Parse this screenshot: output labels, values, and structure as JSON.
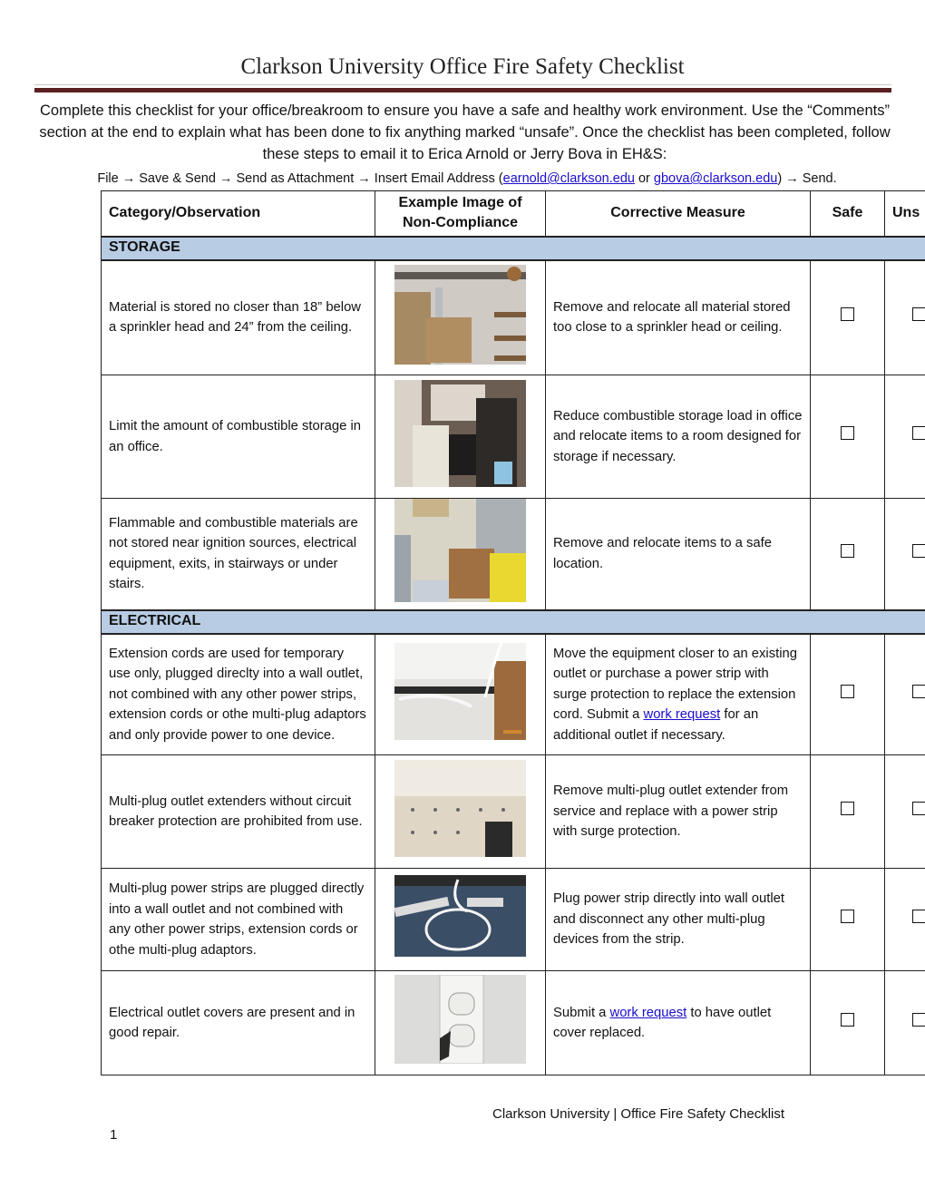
{
  "document": {
    "title": "Clarkson University Office Fire Safety Checklist",
    "intro": "Complete this checklist for your office/breakroom to ensure you have a safe and healthy work environment. Use the “Comments” section at the end to explain what has been done to fix anything marked “unsafe”.  Once the checklist has been completed, follow these steps to email it to Erica Arnold or Jerry Bova in EH&S:",
    "steps": {
      "part1": "File → Save & Send → Send as Attachment → Insert Email Address (",
      "email1": "earnold@clarkson.edu",
      "or": " or ",
      "email2": "gbova@clarkson.edu",
      "part2": ") → Send."
    }
  },
  "table": {
    "headers": {
      "category": "Category/Observation",
      "image": "Example Image of Non-Compliance",
      "measure": "Corrective Measure",
      "safe": "Safe",
      "unsafe": "Uns"
    },
    "sections": [
      {
        "name": "STORAGE",
        "rows": [
          {
            "observation": "Material is stored no closer than 18” below a sprinkler head and 24” from the ceiling.",
            "image_desc": "storage near sprinkler pipe",
            "measure": "Remove and relocate all material stored too close to a sprinkler head or ceiling."
          },
          {
            "observation": "Limit the amount of combustible storage in an office.",
            "image_desc": "cluttered office",
            "measure": "Reduce combustible storage load in office and relocate items to a room designed for storage if necessary."
          },
          {
            "observation": "Flammable and combustible materials are not stored near ignition sources, electrical equipment, exits, in stairways or under stairs.",
            "image_desc": "boxes near electrical panel",
            "measure": "Remove and relocate items to a safe location."
          }
        ]
      },
      {
        "name": "ELECTRICAL",
        "rows": [
          {
            "observation": "Extension cords are used for temporary use only, plugged direclty into a wall outlet, not combined with any other power strips, extension cords or othe multi-plug adaptors and only provide power to one device.",
            "image_desc": "extension cord along wall",
            "measure_pre": "Move the equipment closer to an existing outlet or purchase a power strip with surge protection to replace the extension cord.  Submit a ",
            "measure_link": "work request",
            "measure_post": " for an additional outlet if necessary."
          },
          {
            "observation": "Multi-plug outlet extenders without circuit breaker protection are prohibited from use.",
            "image_desc": "multi-plug outlet extender",
            "measure": "Remove  multi-plug outlet extender from service and replace with a power strip with surge protection."
          },
          {
            "observation": "Multi-plug power strips are plugged directly into a wall outlet and not combined with any other power strips, extension cords or othe multi-plug adaptors.",
            "image_desc": "daisy-chained power strips",
            "measure": "Plug power strip directly into wall outlet and disconnect any other multi-plug devices from the strip."
          },
          {
            "observation": "Electrical outlet covers are present and in good repair.",
            "image_desc": "broken outlet cover",
            "measure_pre": "Submit a ",
            "measure_link": "work request",
            "measure_post": " to have outlet cover replaced."
          }
        ]
      }
    ]
  },
  "footer": {
    "text": "Clarkson University | Office Fire Safety Checklist",
    "page": "1"
  }
}
